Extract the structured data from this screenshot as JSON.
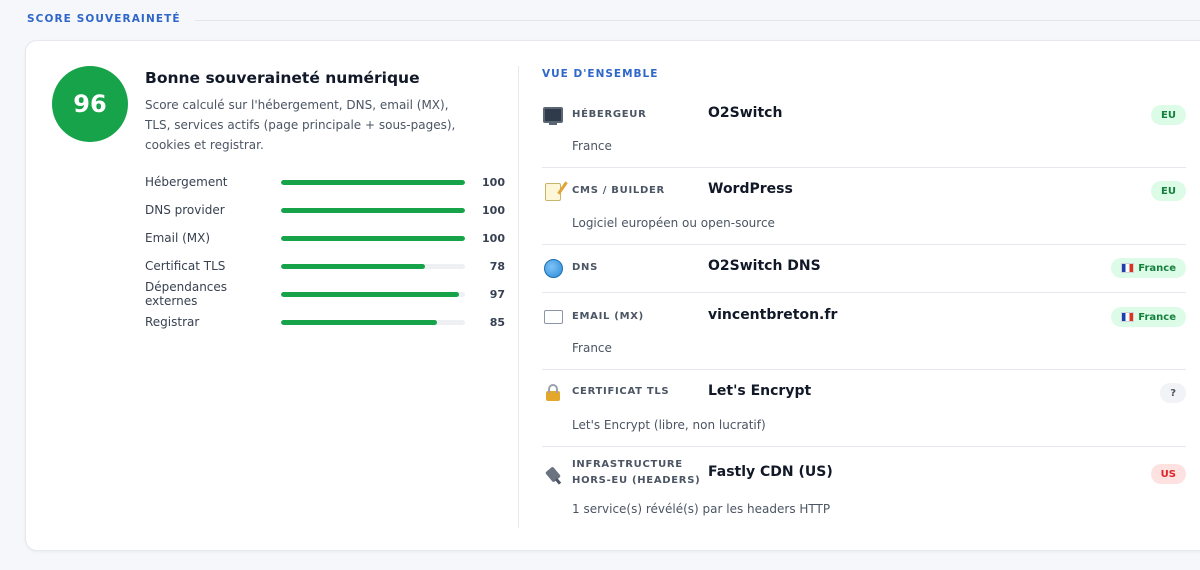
{
  "section": {
    "title": "SCORE SOUVERAINETÉ"
  },
  "score": {
    "value": "96",
    "verdict": "Bonne souveraineté numérique",
    "description": "Score calculé sur l'hébergement, DNS, email (MX), TLS, services actifs (page principale + sous-pages), cookies et registrar.",
    "accent_color": "#16a34a"
  },
  "metrics": [
    {
      "label": "Hébergement",
      "value": "100",
      "percent": 100
    },
    {
      "label": "DNS provider",
      "value": "100",
      "percent": 100
    },
    {
      "label": "Email (MX)",
      "value": "100",
      "percent": 100
    },
    {
      "label": "Certificat TLS",
      "value": "78",
      "percent": 78
    },
    {
      "label": "Dépendances externes",
      "value": "97",
      "percent": 97
    },
    {
      "label": "Registrar",
      "value": "85",
      "percent": 85
    }
  ],
  "overview": {
    "title": "VUE D'ENSEMBLE",
    "rows": [
      {
        "icon": "monitor-icon",
        "label": "HÉBERGEUR",
        "value": "O2Switch",
        "sub": "France",
        "badge": "EU",
        "badge_type": "eu"
      },
      {
        "icon": "memo-icon",
        "label": "CMS / BUILDER",
        "value": "WordPress",
        "sub": "Logiciel européen ou open-source",
        "badge": "EU",
        "badge_type": "eu"
      },
      {
        "icon": "globe-icon",
        "label": "DNS",
        "value": "O2Switch DNS",
        "sub": "",
        "badge": "France",
        "badge_type": "eu-flag"
      },
      {
        "icon": "envelope-icon",
        "label": "EMAIL (MX)",
        "value": "vincentbreton.fr",
        "sub": "France",
        "badge": "France",
        "badge_type": "eu-flag"
      },
      {
        "icon": "lock-icon",
        "label": "CERTIFICAT TLS",
        "value": "Let's Encrypt",
        "sub": "Let's Encrypt (libre, non lucratif)",
        "badge": "?",
        "badge_type": "unknown"
      },
      {
        "icon": "plug-icon",
        "label_line1": "INFRASTRUCTURE",
        "label_line2": "HORS-EU (HEADERS)",
        "value": "Fastly CDN (US)",
        "sub": "1 service(s) révélé(s) par les headers HTTP",
        "badge": "US",
        "badge_type": "us"
      }
    ]
  }
}
